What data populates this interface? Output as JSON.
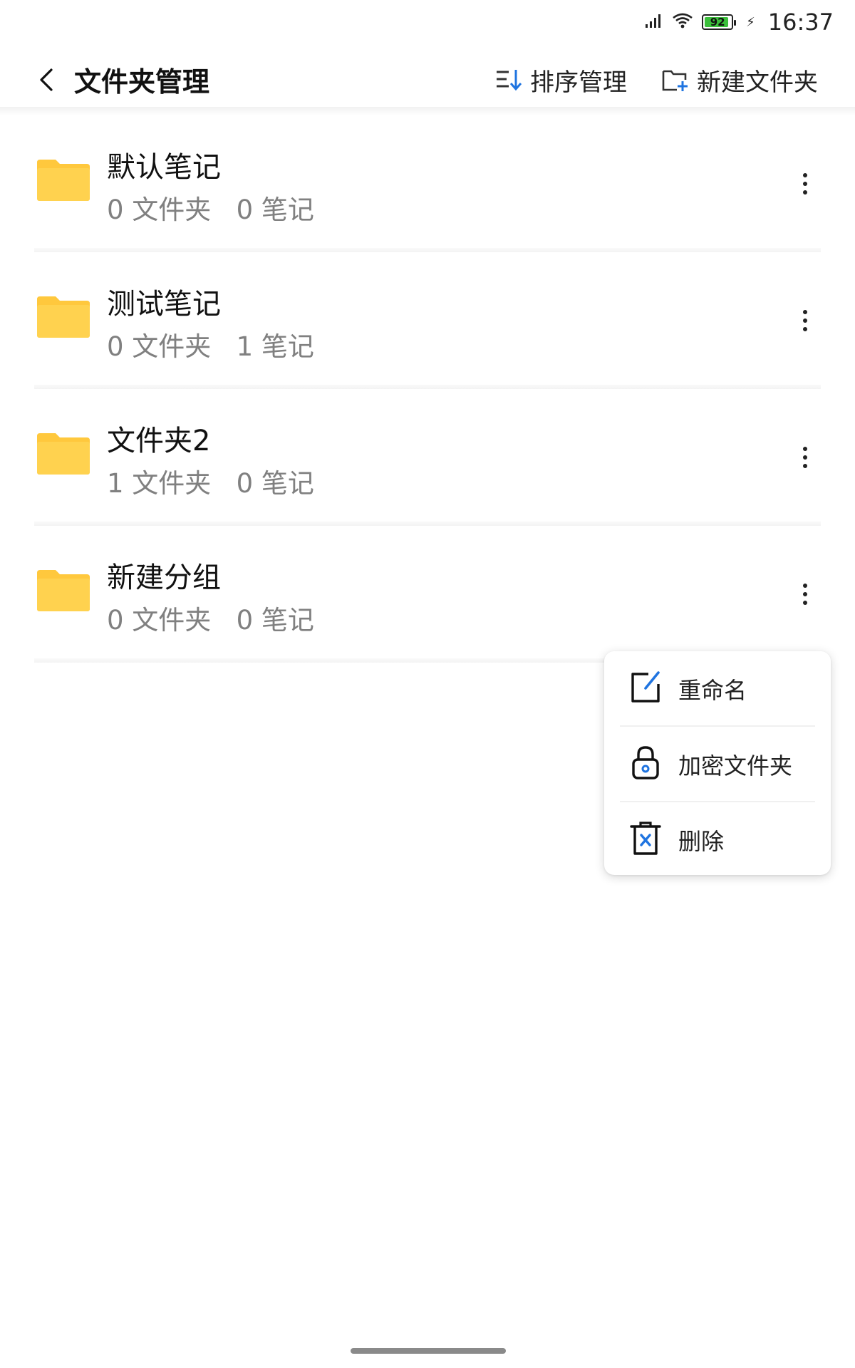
{
  "status_bar": {
    "battery_level": "92",
    "battery_fraction": 0.92,
    "time": "16:37",
    "icons": [
      "signal-icon",
      "wifi-icon",
      "battery-icon",
      "charging-icon"
    ]
  },
  "toolbar": {
    "title": "文件夹管理",
    "sort_label": "排序管理",
    "new_folder_label": "新建文件夹"
  },
  "folders": [
    {
      "name": "默认笔记",
      "meta": "0 文件夹   0 笔记"
    },
    {
      "name": "测试笔记",
      "meta": "0 文件夹   1 笔记"
    },
    {
      "name": "文件夹2",
      "meta": "1 文件夹   0 笔记"
    },
    {
      "name": "新建分组",
      "meta": "0 文件夹   0 笔记"
    }
  ],
  "context_menu": {
    "items": [
      {
        "label": "重命名",
        "icon": "edit-icon"
      },
      {
        "label": "加密文件夹",
        "icon": "lock-icon"
      },
      {
        "label": "删除",
        "icon": "trash-icon"
      }
    ]
  },
  "colors": {
    "folder": "#FFC83D",
    "accent": "#1F74E0",
    "meta_text": "#808080"
  }
}
